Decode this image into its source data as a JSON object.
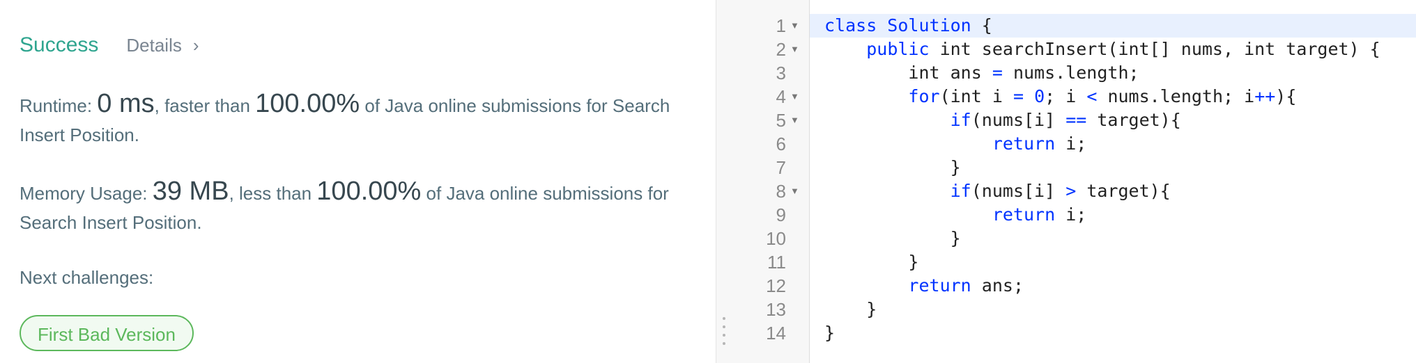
{
  "result": {
    "status": "Success",
    "details_label": "Details",
    "details_chevron": "›",
    "runtime": {
      "prefix": "Runtime: ",
      "value": "0 ms",
      "middle": ", faster than ",
      "percent": "100.00%",
      "suffix": " of Java online submissions for Search Insert Position."
    },
    "memory": {
      "prefix": "Memory Usage: ",
      "value": "39 MB",
      "middle": ", less than ",
      "percent": "100.00%",
      "suffix": " of Java online submissions for Search Insert Position."
    },
    "next_label": "Next challenges:",
    "challenges": [
      "First Bad Version"
    ]
  },
  "colors": {
    "success": "#2fa58f",
    "keyword": "#0033ff",
    "challenge_green": "#5cb85c",
    "active_line": "#e8f0fe"
  },
  "icons": {
    "fold": "fold-arrow-icon",
    "splitter": "drag-handle-icon"
  },
  "editor": {
    "active_line": 1,
    "lines": [
      {
        "num": "1",
        "fold": "▼",
        "tokens": [
          {
            "t": "class Solution",
            "k": true
          },
          {
            "t": " {",
            "k": false
          }
        ]
      },
      {
        "num": "2",
        "fold": "▼",
        "tokens": [
          {
            "t": "    ",
            "k": false
          },
          {
            "t": "public",
            "k": true
          },
          {
            "t": " int searchInsert(int[] nums, int target) {",
            "k": false
          }
        ]
      },
      {
        "num": "3",
        "fold": "",
        "tokens": [
          {
            "t": "        int ans ",
            "k": false
          },
          {
            "t": "=",
            "k": true
          },
          {
            "t": " nums.length;",
            "k": false
          }
        ]
      },
      {
        "num": "4",
        "fold": "▼",
        "tokens": [
          {
            "t": "        ",
            "k": false
          },
          {
            "t": "for",
            "k": true
          },
          {
            "t": "(int i ",
            "k": false
          },
          {
            "t": "=",
            "k": true
          },
          {
            "t": " ",
            "k": false
          },
          {
            "t": "0",
            "k": true
          },
          {
            "t": "; i ",
            "k": false
          },
          {
            "t": "<",
            "k": true
          },
          {
            "t": " nums.length; i",
            "k": false
          },
          {
            "t": "++",
            "k": true
          },
          {
            "t": "){",
            "k": false
          }
        ]
      },
      {
        "num": "5",
        "fold": "▼",
        "tokens": [
          {
            "t": "            ",
            "k": false
          },
          {
            "t": "if",
            "k": true
          },
          {
            "t": "(nums[i] ",
            "k": false
          },
          {
            "t": "==",
            "k": true
          },
          {
            "t": " target){",
            "k": false
          }
        ]
      },
      {
        "num": "6",
        "fold": "",
        "tokens": [
          {
            "t": "                ",
            "k": false
          },
          {
            "t": "return",
            "k": true
          },
          {
            "t": " i;",
            "k": false
          }
        ]
      },
      {
        "num": "7",
        "fold": "",
        "tokens": [
          {
            "t": "            }",
            "k": false
          }
        ]
      },
      {
        "num": "8",
        "fold": "▼",
        "tokens": [
          {
            "t": "            ",
            "k": false
          },
          {
            "t": "if",
            "k": true
          },
          {
            "t": "(nums[i] ",
            "k": false
          },
          {
            "t": ">",
            "k": true
          },
          {
            "t": " target){",
            "k": false
          }
        ]
      },
      {
        "num": "9",
        "fold": "",
        "tokens": [
          {
            "t": "                ",
            "k": false
          },
          {
            "t": "return",
            "k": true
          },
          {
            "t": " i;",
            "k": false
          }
        ]
      },
      {
        "num": "10",
        "fold": "",
        "tokens": [
          {
            "t": "            }",
            "k": false
          }
        ]
      },
      {
        "num": "11",
        "fold": "",
        "tokens": [
          {
            "t": "        }",
            "k": false
          }
        ]
      },
      {
        "num": "12",
        "fold": "",
        "tokens": [
          {
            "t": "        ",
            "k": false
          },
          {
            "t": "return",
            "k": true
          },
          {
            "t": " ans;",
            "k": false
          }
        ]
      },
      {
        "num": "13",
        "fold": "",
        "tokens": [
          {
            "t": "    }",
            "k": false
          }
        ]
      },
      {
        "num": "14",
        "fold": "",
        "tokens": [
          {
            "t": "}",
            "k": false
          }
        ]
      }
    ]
  }
}
